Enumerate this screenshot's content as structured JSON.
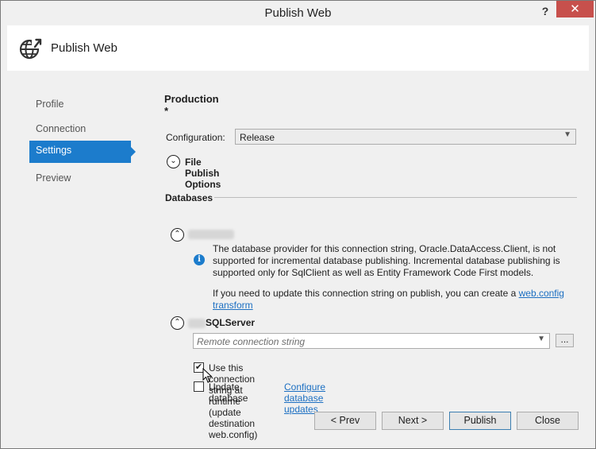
{
  "window": {
    "title": "Publish Web",
    "help_label": "?",
    "close_label": "✕"
  },
  "header": {
    "icon": "globe-publish-icon",
    "title": "Publish Web"
  },
  "sidebar": {
    "items": [
      {
        "label": "Profile",
        "active": false
      },
      {
        "label": "Connection",
        "active": false
      },
      {
        "label": "Settings",
        "active": true
      },
      {
        "label": "Preview",
        "active": false
      }
    ]
  },
  "main": {
    "profile_name": "Production *",
    "configuration": {
      "label": "Configuration:",
      "value": "Release"
    },
    "file_publish_options": {
      "label": "File Publish Options",
      "expander": "⌄"
    },
    "databases": {
      "section_label": "Databases",
      "connection1": {
        "expander": "⌃",
        "info_text": "The database provider for this connection string, Oracle.DataAccess.Client, is not supported for incremental database publishing. Incremental database publishing is supported only for SqlClient as well as Entity Framework Code First models.",
        "update_text": "If you need to update this connection string on publish, you can create a",
        "update_link": "web.config transform"
      },
      "connection2": {
        "expander": "⌃",
        "name_suffix": "SQLServer",
        "remote_placeholder": "Remote connection string",
        "browse_label": "...",
        "use_runtime": {
          "label": "Use this connection string at runtime (update destination web.config)",
          "checked": true
        },
        "update_database": {
          "label": "Update database",
          "checked": false
        },
        "configure_link": "Configure database updates"
      }
    }
  },
  "footer": {
    "prev_label": "< Prev",
    "next_label": "Next >",
    "publish_label": "Publish",
    "close_label": "Close"
  },
  "colors": {
    "accent": "#1c7ccc",
    "close_button": "#c7504c",
    "link": "#1c6fc2",
    "window_bg": "#f0f0f0"
  }
}
